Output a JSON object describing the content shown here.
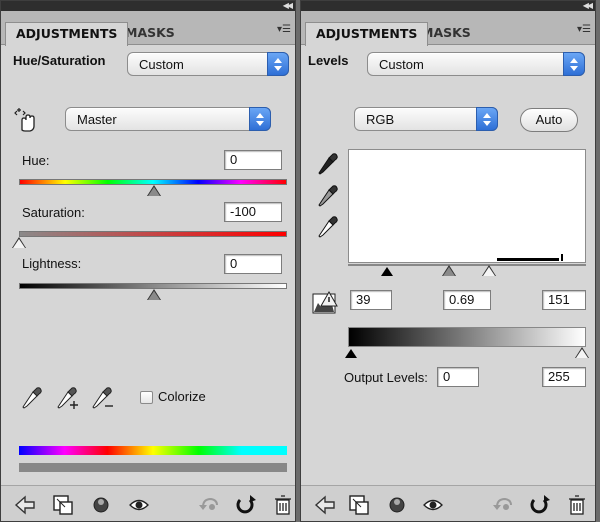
{
  "left_panel": {
    "tabs": [
      "ADJUSTMENTS",
      "MASKS"
    ],
    "title": "Hue/Saturation",
    "preset": "Custom",
    "channel": "Master",
    "hue": {
      "label": "Hue:",
      "value": "0"
    },
    "saturation": {
      "label": "Saturation:",
      "value": "-100"
    },
    "lightness": {
      "label": "Lightness:",
      "value": "0"
    },
    "colorize_label": "Colorize",
    "colorize_checked": false,
    "slider_levels": {
      "hue": 0.5,
      "saturation": 0.0,
      "lightness": 0.5
    }
  },
  "right_panel": {
    "tabs": [
      "ADJUSTMENTS",
      "MASKS"
    ],
    "title": "Levels",
    "preset": "Custom",
    "channel": "RGB",
    "auto_label": "Auto",
    "input_levels": {
      "black": "39",
      "gamma": "0.69",
      "white": "151"
    },
    "output_levels_label": "Output Levels:",
    "output_levels": {
      "black": "0",
      "white": "255"
    }
  },
  "footer_icons": [
    "back-arrow-icon",
    "clip-to-layer-icon",
    "visibility-toggle-icon",
    "eye-icon",
    "previous-state-icon",
    "reset-icon",
    "trash-icon"
  ],
  "colors": {
    "panel_bg": "#d6d6d6",
    "select_accent": "#2e6fd6",
    "dark_bar": "#2e2e2e"
  }
}
